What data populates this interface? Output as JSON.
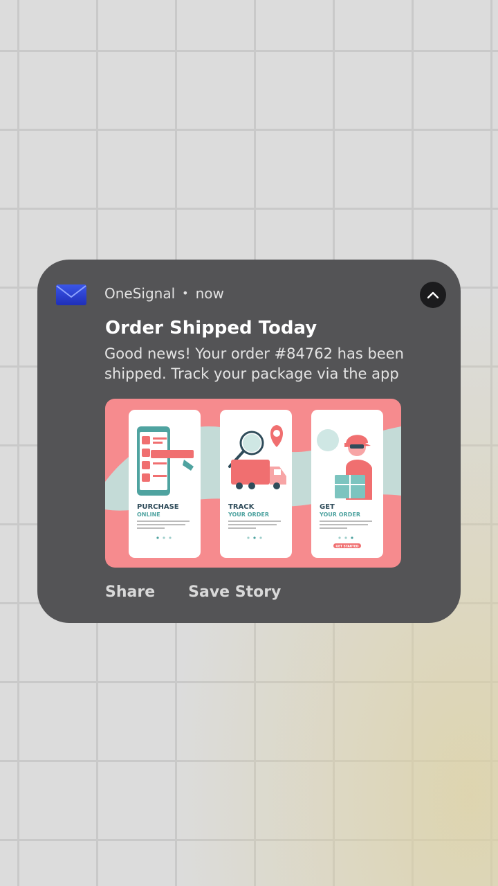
{
  "notification": {
    "app_name": "OneSignal",
    "separator": "•",
    "time": "now",
    "title": "Order Shipped Today",
    "body": "Good news! Your order #84762 has been shipped. Track your package via the app",
    "app_icon": "envelope-icon",
    "collapse_icon": "chevron-up-icon",
    "actions": [
      {
        "label": "Share"
      },
      {
        "label": "Save Story"
      }
    ]
  },
  "image": {
    "panels": [
      {
        "title": "PURCHASE",
        "subtitle": "ONLINE"
      },
      {
        "title": "TRACK",
        "subtitle": "YOUR ORDER"
      },
      {
        "title": "GET",
        "subtitle": "YOUR ORDER",
        "button": "GET STARTED"
      }
    ],
    "caption": "Lorem ipsum dolor sit amet, consectetur adipiscing elit. Nunc mollis lacus fermentum rhoncus."
  },
  "colors": {
    "card_bg": "#545456",
    "image_bg": "#f68b8e",
    "teal": "#4fa3a0",
    "pink": "#f06f70",
    "icon_blue": "#2f45d8"
  }
}
